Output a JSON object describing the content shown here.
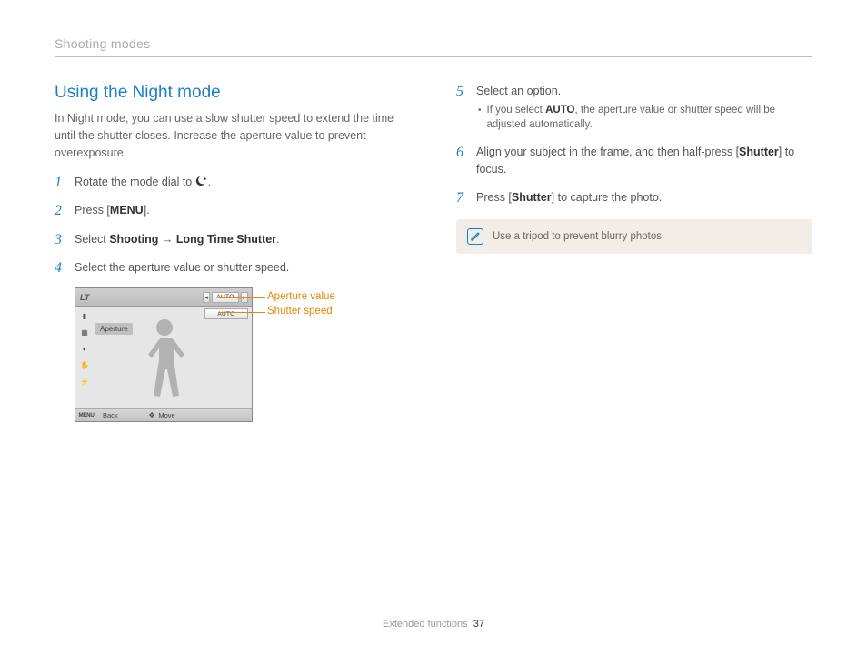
{
  "header": "Shooting modes",
  "title": "Using the Night mode",
  "intro": "In Night mode, you can use a slow shutter speed to extend the time until the shutter closes. Increase the aperture value to prevent overexposure.",
  "left_steps": {
    "s1_pre": "Rotate the mode dial to ",
    "s1_post": ".",
    "s2_pre": "Press [",
    "s2_bold": "MENU",
    "s2_post": "].",
    "s3_pre": "Select ",
    "s3_b1": "Shooting",
    "s3_mid": " → ",
    "s3_b2": "Long Time Shutter",
    "s3_post": ".",
    "s4": "Select the aperture value or shutter speed."
  },
  "lcd": {
    "lt": "LT",
    "auto": "AUTO",
    "aperture": "Aperture",
    "menu": "MENU",
    "back": "Back",
    "move": "Move",
    "callout1": "Aperture value",
    "callout2": "Shutter speed"
  },
  "right_steps": {
    "s5": "Select an option.",
    "s5_sub_pre": "If you select ",
    "s5_sub_bold": "AUTO",
    "s5_sub_post": ", the aperture value or shutter speed will be adjusted automatically.",
    "s6_pre": "Align your subject in the frame, and then half-press [",
    "s6_bold": "Shutter",
    "s6_post": "] to focus.",
    "s7_pre": "Press [",
    "s7_bold": "Shutter",
    "s7_post": "] to capture the photo."
  },
  "note": "Use a tripod to prevent blurry photos.",
  "footer_label": "Extended functions",
  "footer_page": "37"
}
